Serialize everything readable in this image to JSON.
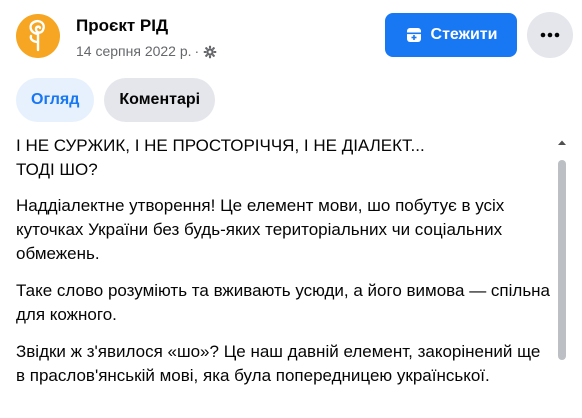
{
  "header": {
    "page_name": "Проєкт РІД",
    "date": "14 серпня 2022 р.",
    "separator": "·",
    "audience_icon": "gear-icon",
    "avatar_icon": "rid-logo-icon",
    "follow_label": "Стежити",
    "follow_icon": "add-to-following-icon",
    "more_icon": "more-dots-icon"
  },
  "tabs": [
    {
      "label": "Огляд",
      "active": true
    },
    {
      "label": "Коментарі",
      "active": false
    }
  ],
  "post": {
    "headline_line1": "І НЕ СУРЖИК, І НЕ ПРОСТОРІЧЧЯ, І НЕ ДІАЛЕКТ...",
    "headline_line2": "ТОДІ ШО?",
    "paragraphs": [
      "Наддіалектне утворення! Це елемент мови, шо побутує в усіх куточках України без будь-яких територіальних чи соціальних обмежень.",
      "Таке слово розуміють та вживають усюди, а його вимова — спільна для кожного.",
      "Звідки ж з'явилося «шо»? Це наш давній елемент, закорінений ще в праслов'янській мові, яка була попередницею української."
    ]
  },
  "colors": {
    "accent": "#1877f2",
    "avatar_bg": "#f6a623",
    "tab_active_bg": "#e7f0fd",
    "button_grey": "#e4e6eb",
    "meta_text": "#65676b"
  }
}
